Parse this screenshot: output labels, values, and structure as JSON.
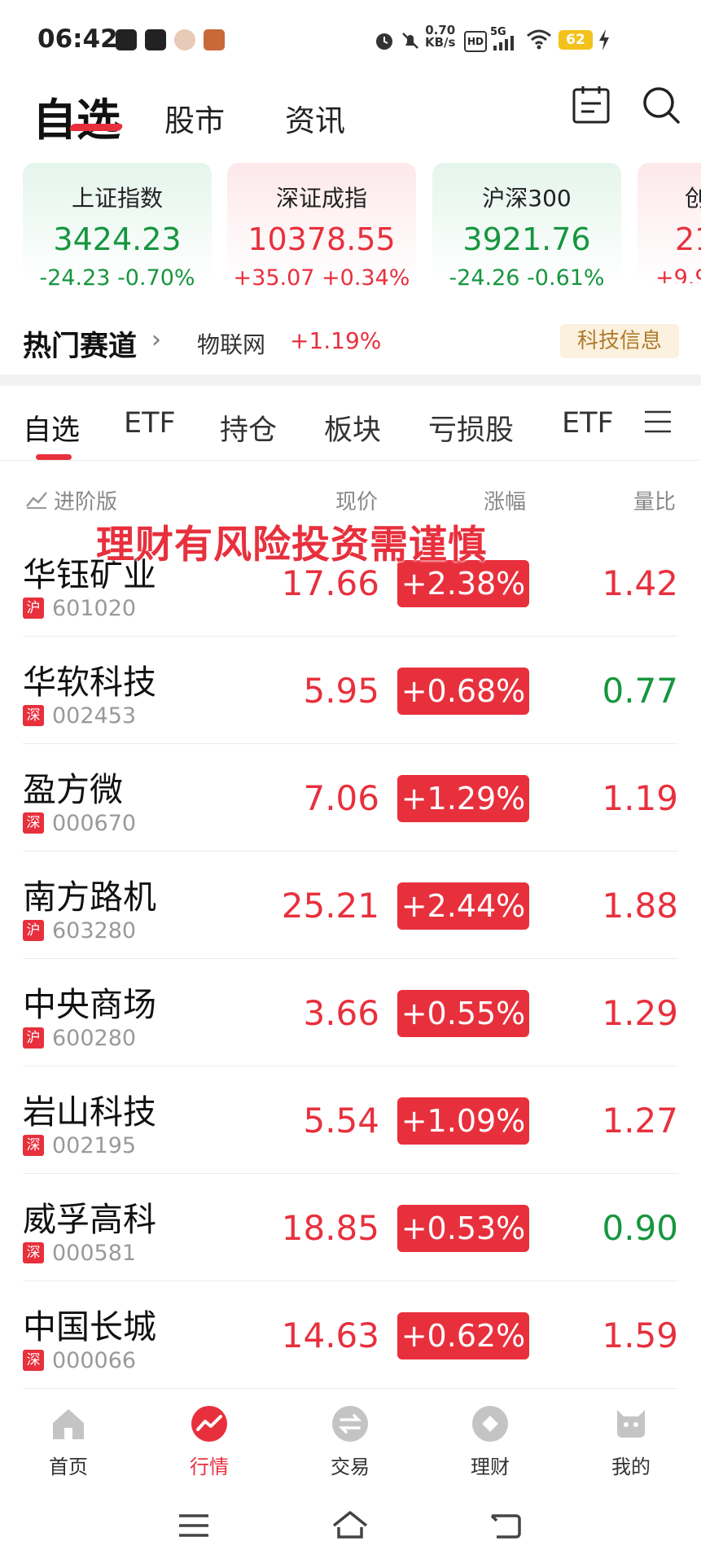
{
  "status_bar": {
    "time": "06:42",
    "net_speed_value": "0.70",
    "net_speed_unit": "KB/s",
    "hd": "HD",
    "signal": "5G",
    "battery": "62"
  },
  "header": {
    "tabs": [
      "自选",
      "股市",
      "资讯"
    ],
    "active_tab": "自选",
    "icons": [
      "notepad-icon",
      "search-icon"
    ]
  },
  "indices": [
    {
      "name": "上证指数",
      "value": "3424.23",
      "change": "-24.23",
      "pct": "-0.70%",
      "trend": "down"
    },
    {
      "name": "深证成指",
      "value": "10378.55",
      "change": "+35.07",
      "pct": "+0.34%",
      "trend": "up"
    },
    {
      "name": "沪深300",
      "value": "3921.76",
      "change": "-24.26",
      "pct": "-0.61%",
      "trend": "down"
    },
    {
      "name": "创",
      "value": "21",
      "change": "+9.9",
      "pct": "",
      "trend": "up"
    }
  ],
  "hot_track": {
    "title": "热门赛道",
    "sector": "物联网",
    "change": "+1.19%",
    "tag": "科技信息"
  },
  "sub_tabs": [
    "自选",
    "ETF",
    "持仓",
    "板块",
    "亏损股",
    "ETF"
  ],
  "columns": {
    "advanced": "进阶版",
    "price": "现价",
    "change": "涨幅",
    "volume_ratio": "量比"
  },
  "watermark": "理财有风险投资需谨慎",
  "stocks": [
    {
      "name": "华钰矿业",
      "market": "沪",
      "code": "601020",
      "price": "17.66",
      "change": "+2.38%",
      "volume_ratio": "1.42",
      "vr_color": "red"
    },
    {
      "name": "华软科技",
      "market": "深",
      "code": "002453",
      "price": "5.95",
      "change": "+0.68%",
      "volume_ratio": "0.77",
      "vr_color": "green"
    },
    {
      "name": "盈方微",
      "market": "深",
      "code": "000670",
      "price": "7.06",
      "change": "+1.29%",
      "volume_ratio": "1.19",
      "vr_color": "red"
    },
    {
      "name": "南方路机",
      "market": "沪",
      "code": "603280",
      "price": "25.21",
      "change": "+2.44%",
      "volume_ratio": "1.88",
      "vr_color": "red"
    },
    {
      "name": "中央商场",
      "market": "沪",
      "code": "600280",
      "price": "3.66",
      "change": "+0.55%",
      "volume_ratio": "1.29",
      "vr_color": "red"
    },
    {
      "name": "岩山科技",
      "market": "深",
      "code": "002195",
      "price": "5.54",
      "change": "+1.09%",
      "volume_ratio": "1.27",
      "vr_color": "red"
    },
    {
      "name": "威孚高科",
      "market": "深",
      "code": "000581",
      "price": "18.85",
      "change": "+0.53%",
      "volume_ratio": "0.90",
      "vr_color": "green"
    },
    {
      "name": "中国长城",
      "market": "深",
      "code": "000066",
      "price": "14.63",
      "change": "+0.62%",
      "volume_ratio": "1.59",
      "vr_color": "red"
    }
  ],
  "bottom_nav": [
    {
      "label": "首页",
      "icon": "home-icon"
    },
    {
      "label": "行情",
      "icon": "market-icon",
      "active": true
    },
    {
      "label": "交易",
      "icon": "exchange-icon"
    },
    {
      "label": "理财",
      "icon": "wealth-icon"
    },
    {
      "label": "我的",
      "icon": "profile-icon"
    }
  ],
  "colors": {
    "red": "#e8303d",
    "green": "#16963f",
    "tag_bg": "#fbf1de",
    "tag_text": "#b07b2c"
  }
}
